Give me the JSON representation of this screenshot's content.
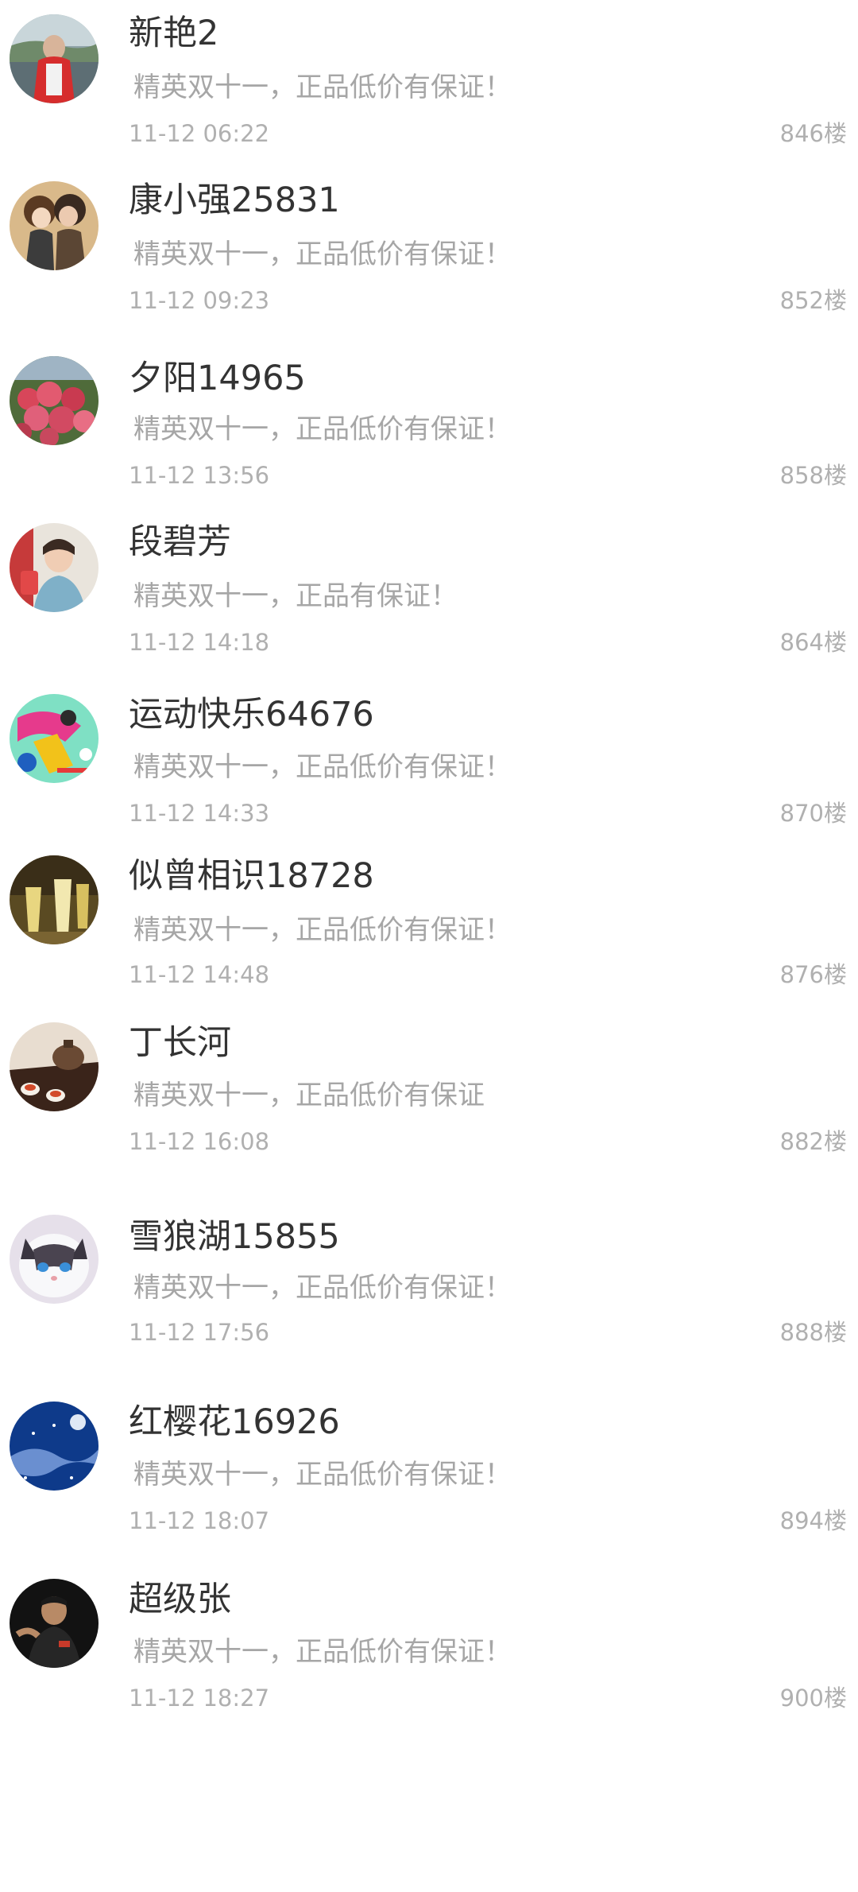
{
  "comments": [
    {
      "user": "新艳2",
      "text": "精英双十一，正品低价有保证！",
      "time": "11-12 06:22",
      "floor": "846楼",
      "avatar": "avatar-person-red-coat"
    },
    {
      "user": "康小强25831",
      "text": "精英双十一，正品低价有保证！",
      "time": "11-12 09:23",
      "floor": "852楼",
      "avatar": "avatar-anime-couple"
    },
    {
      "user": "夕阳14965",
      "text": "精英双十一，正品低价有保证！",
      "time": "11-12 13:56",
      "floor": "858楼",
      "avatar": "avatar-flowers"
    },
    {
      "user": "段碧芳",
      "text": "精英双十一，正品有保证！",
      "time": "11-12 14:18",
      "floor": "864楼",
      "avatar": "avatar-woman-portrait"
    },
    {
      "user": "运动快乐64676",
      "text": "精英双十一，正品低价有保证！",
      "time": "11-12 14:33",
      "floor": "870楼",
      "avatar": "avatar-table-tennis"
    },
    {
      "user": "似曾相识18728",
      "text": "精英双十一，正品低价有保证！",
      "time": "11-12 14:48",
      "floor": "876楼",
      "avatar": "avatar-drinks"
    },
    {
      "user": "丁长河",
      "text": "精英双十一，正品低价有保证",
      "time": "11-12 16:08",
      "floor": "882楼",
      "avatar": "avatar-tea-set"
    },
    {
      "user": "雪狼湖15855",
      "text": "精英双十一，正品低价有保证！",
      "time": "11-12 17:56",
      "floor": "888楼",
      "avatar": "avatar-cat"
    },
    {
      "user": "红樱花16926",
      "text": "精英双十一，正品低价有保证！",
      "time": "11-12 18:07",
      "floor": "894楼",
      "avatar": "avatar-night-sky"
    },
    {
      "user": "超级张",
      "text": "精英双十一，正品低价有保证！",
      "time": "11-12 18:27",
      "floor": "900楼",
      "avatar": "avatar-man-dark"
    }
  ]
}
